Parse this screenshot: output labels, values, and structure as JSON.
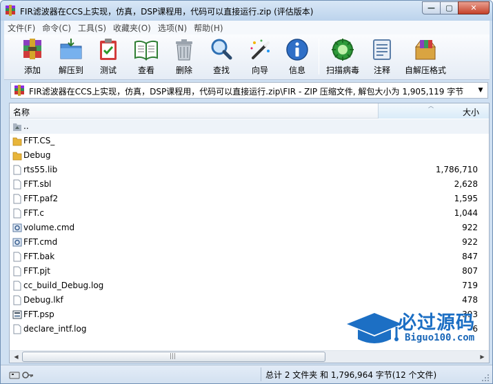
{
  "window": {
    "title": "FIR滤波器在CCS上实现，仿真，DSP课程用，代码可以直接运行.zip (评估版本)",
    "minimize_glyph": "—",
    "maximize_glyph": "▢",
    "close_glyph": "✕"
  },
  "menu": [
    "文件(F)",
    "命令(C)",
    "工具(S)",
    "收藏夹(O)",
    "选项(N)",
    "帮助(H)"
  ],
  "toolbar": [
    {
      "label": "添加",
      "icon": "add-archive-icon"
    },
    {
      "label": "解压到",
      "icon": "extract-folder-icon"
    },
    {
      "label": "测试",
      "icon": "test-clipboard-icon"
    },
    {
      "label": "查看",
      "icon": "view-book-icon"
    },
    {
      "label": "删除",
      "icon": "trash-icon"
    },
    {
      "label": "查找",
      "icon": "magnifier-icon"
    },
    {
      "label": "向导",
      "icon": "wizard-wand-icon"
    },
    {
      "label": "信息",
      "icon": "info-icon"
    },
    {
      "label": "扫描病毒",
      "icon": "virus-scan-icon"
    },
    {
      "label": "注释",
      "icon": "comment-icon"
    },
    {
      "label": "自解压格式",
      "icon": "sfx-box-icon"
    }
  ],
  "address": {
    "path": "FIR滤波器在CCS上实现，仿真，DSP课程用，代码可以直接运行.zip\\FIR - ZIP 压缩文件, 解包大小为 1,905,119 字节",
    "dropdown_glyph": "▼"
  },
  "columns": {
    "name": "名称",
    "size": "大小",
    "sort_glyph": "︿"
  },
  "files": [
    {
      "name": "..",
      "size": "",
      "type": "parent"
    },
    {
      "name": "FFT.CS_",
      "size": "",
      "type": "folder"
    },
    {
      "name": "Debug",
      "size": "",
      "type": "folder"
    },
    {
      "name": "rts55.lib",
      "size": "1,786,710",
      "type": "file"
    },
    {
      "name": "FFT.sbl",
      "size": "2,628",
      "type": "file"
    },
    {
      "name": "FFT.paf2",
      "size": "1,595",
      "type": "file"
    },
    {
      "name": "FFT.c",
      "size": "1,044",
      "type": "file"
    },
    {
      "name": "volume.cmd",
      "size": "922",
      "type": "cmd"
    },
    {
      "name": "FFT.cmd",
      "size": "922",
      "type": "cmd"
    },
    {
      "name": "FFT.bak",
      "size": "847",
      "type": "file"
    },
    {
      "name": "FFT.pjt",
      "size": "807",
      "type": "file"
    },
    {
      "name": "cc_build_Debug.log",
      "size": "719",
      "type": "file"
    },
    {
      "name": "Debug.lkf",
      "size": "478",
      "type": "file"
    },
    {
      "name": "FFT.psp",
      "size": "393",
      "type": "psp"
    },
    {
      "name": "declare_intf.log",
      "size": "6",
      "type": "file"
    }
  ],
  "watermark": {
    "title": "必过源码",
    "url": "Biguo100.com"
  },
  "scrollbar": {
    "left_glyph": "◀",
    "right_glyph": "▶",
    "grip_glyph": "|||"
  },
  "status": {
    "text": "总计 2 文件夹 和 1,796,964 字节(12 个文件)"
  },
  "colors": {
    "accent": "#1c6fc4",
    "window_frame": "#cfe0f2",
    "close_button": "#c5412a"
  }
}
